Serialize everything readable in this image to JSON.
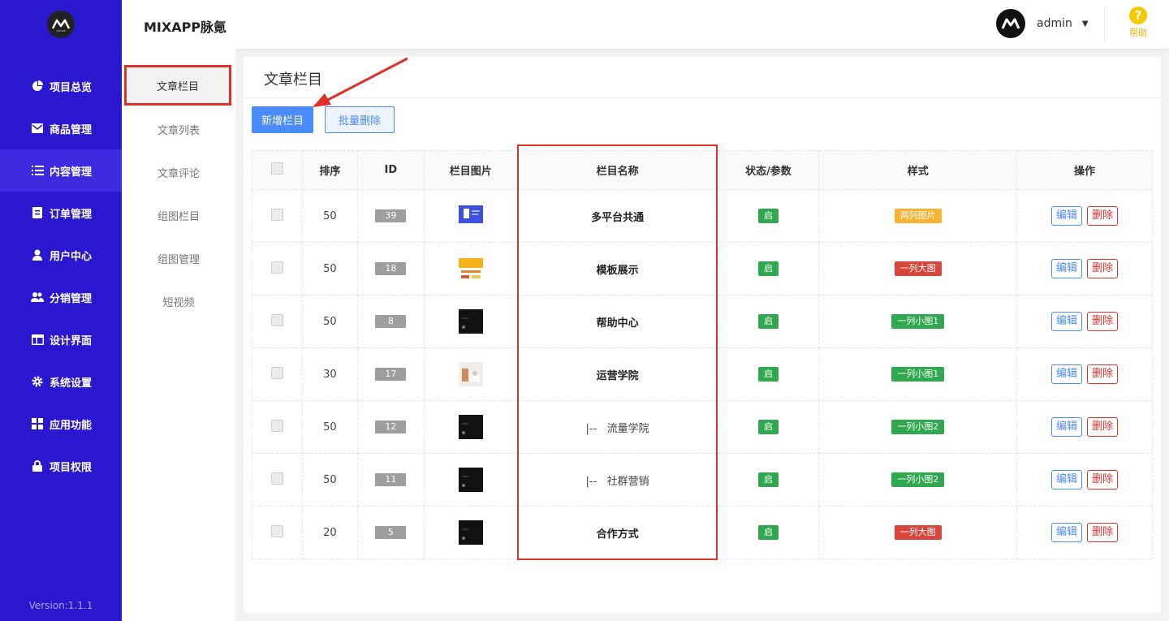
{
  "app": {
    "title": "MIXAPP脉氪",
    "version": "Version:1.1.1",
    "logo_text": "MIXAPP"
  },
  "user": {
    "name": "admin"
  },
  "help": {
    "label": "帮助"
  },
  "sidebar": {
    "items": [
      {
        "label": "项目总览",
        "icon": "pie-chart-icon"
      },
      {
        "label": "商品管理",
        "icon": "envelope-icon"
      },
      {
        "label": "内容管理",
        "icon": "list-icon"
      },
      {
        "label": "订单管理",
        "icon": "document-icon"
      },
      {
        "label": "用户中心",
        "icon": "user-icon"
      },
      {
        "label": "分销管理",
        "icon": "users-icon"
      },
      {
        "label": "设计界面",
        "icon": "layout-icon"
      },
      {
        "label": "系统设置",
        "icon": "gear-icon"
      },
      {
        "label": "应用功能",
        "icon": "grid-icon"
      },
      {
        "label": "项目权限",
        "icon": "lock-icon"
      }
    ],
    "active": "内容管理"
  },
  "subnav": {
    "items": [
      "文章栏目",
      "文章列表",
      "文章评论",
      "组图栏目",
      "组图管理",
      "短视频"
    ],
    "active": "文章栏目"
  },
  "page": {
    "title": "文章栏目",
    "add_button": "新增栏目",
    "batch_delete_button": "批量删除"
  },
  "table": {
    "headers": [
      "",
      "排序",
      "ID",
      "栏目图片",
      "栏目名称",
      "状态/参数",
      "样式",
      "操作"
    ],
    "rows": [
      {
        "sort": "50",
        "id": "39",
        "thumb": "thumb-blue",
        "name": "多平台共通",
        "child": false,
        "status": "启",
        "style": "两列图片",
        "style_color": "orange",
        "edit": "编辑",
        "delete": "删除"
      },
      {
        "sort": "50",
        "id": "18",
        "thumb": "thumb-yellow",
        "name": "模板展示",
        "child": false,
        "status": "启",
        "style": "一列大图",
        "style_color": "red",
        "edit": "编辑",
        "delete": "删除"
      },
      {
        "sort": "50",
        "id": "8",
        "thumb": "thumb-dark",
        "name": "帮助中心",
        "child": false,
        "status": "启",
        "style": "一列小图1",
        "style_color": "green",
        "edit": "编辑",
        "delete": "删除"
      },
      {
        "sort": "30",
        "id": "17",
        "thumb": "thumb-light",
        "name": "运营学院",
        "child": false,
        "status": "启",
        "style": "一列小图1",
        "style_color": "green",
        "edit": "编辑",
        "delete": "删除"
      },
      {
        "sort": "50",
        "id": "12",
        "thumb": "thumb-dark",
        "name": "|--   流量学院",
        "child": true,
        "status": "启",
        "style": "一列小图2",
        "style_color": "green",
        "edit": "编辑",
        "delete": "删除"
      },
      {
        "sort": "50",
        "id": "11",
        "thumb": "thumb-dark",
        "name": "|--   社群营销",
        "child": true,
        "status": "启",
        "style": "一列小图2",
        "style_color": "green",
        "edit": "编辑",
        "delete": "删除"
      },
      {
        "sort": "20",
        "id": "5",
        "thumb": "thumb-dark",
        "name": "合作方式",
        "child": false,
        "status": "启",
        "style": "一列大图",
        "style_color": "red",
        "edit": "编辑",
        "delete": "删除"
      }
    ]
  },
  "colors": {
    "sidebar_bg": "#2a17d0",
    "primary": "#4a8bff",
    "tag_green": "#2fa84f",
    "tag_orange": "#f8b335",
    "tag_red": "#d9453a",
    "highlight": "#e0302a"
  }
}
